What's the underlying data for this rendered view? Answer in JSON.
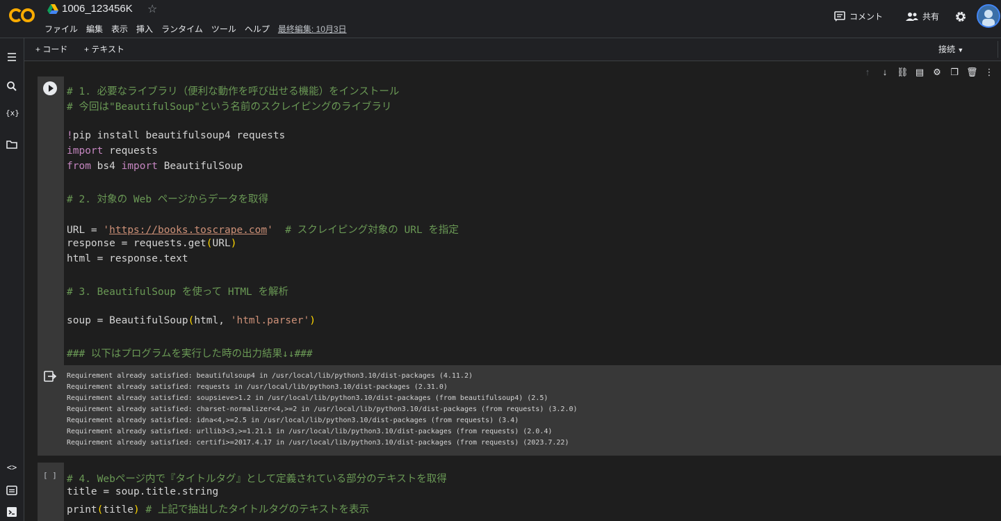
{
  "header": {
    "notebook_title": "1006_123456K",
    "menu": [
      "ファイル",
      "編集",
      "表示",
      "挿入",
      "ランタイム",
      "ツール",
      "ヘルプ"
    ],
    "last_edited": "最終編集: 10月3日",
    "comment_label": "コメント",
    "share_label": "共有"
  },
  "toolbar": {
    "add_code": "+ コード",
    "add_text": "+ テキスト",
    "connect": "接続"
  },
  "cell1": {
    "lines": {
      "l1": "# 1. 必要なライブラリ（便利な動作を呼び出せる機能）をインストール",
      "l2": "# 今回は\"BeautifulSoup\"という名前のスクレイピングのライブラリ",
      "l4a": "!",
      "l4b": "pip install beautifulsoup4 requests",
      "l5a": "import",
      "l5b": " requests",
      "l6a": "from",
      "l6b": " bs4 ",
      "l6c": "import",
      "l6d": " BeautifulSoup",
      "l8": "# 2. 対象の Web ページからデータを取得",
      "l10a": "URL = ",
      "l10b": "'",
      "l10c": "https://books.toscrape.com",
      "l10d": "'",
      "l10e": "  # スクレイピング対象の URL を指定",
      "l11a": "response = requests.get",
      "l11b": "(",
      "l11c": "URL",
      "l11d": ")",
      "l12": "html = response.text",
      "l14": "# 3. BeautifulSoup を使って HTML を解析",
      "l16a": "soup = BeautifulSoup",
      "l16b": "(",
      "l16c": "html, ",
      "l16d": "'html.parser'",
      "l16e": ")",
      "l18": "### 以下はプログラムを実行した時の出力結果↓↓###"
    }
  },
  "output": {
    "lines": [
      "Requirement already satisfied: beautifulsoup4 in /usr/local/lib/python3.10/dist-packages (4.11.2)",
      "Requirement already satisfied: requests in /usr/local/lib/python3.10/dist-packages (2.31.0)",
      "Requirement already satisfied: soupsieve>1.2 in /usr/local/lib/python3.10/dist-packages (from beautifulsoup4) (2.5)",
      "Requirement already satisfied: charset-normalizer<4,>=2 in /usr/local/lib/python3.10/dist-packages (from requests) (3.2.0)",
      "Requirement already satisfied: idna<4,>=2.5 in /usr/local/lib/python3.10/dist-packages (from requests) (3.4)",
      "Requirement already satisfied: urllib3<3,>=1.21.1 in /usr/local/lib/python3.10/dist-packages (from requests) (2.0.4)",
      "Requirement already satisfied: certifi>=2017.4.17 in /usr/local/lib/python3.10/dist-packages (from requests) (2023.7.22)"
    ]
  },
  "cell2": {
    "bracket": "[ ]",
    "l1": "# 4. Webページ内で『タイトルタグ』として定義されている部分のテキストを取得",
    "l2": "title = soup.title.string",
    "l3a": "print",
    "l3b": "(",
    "l3c": "title",
    "l3d": ")",
    "l3e": " # 上記で抽出したタイトルタグのテキストを表示"
  }
}
